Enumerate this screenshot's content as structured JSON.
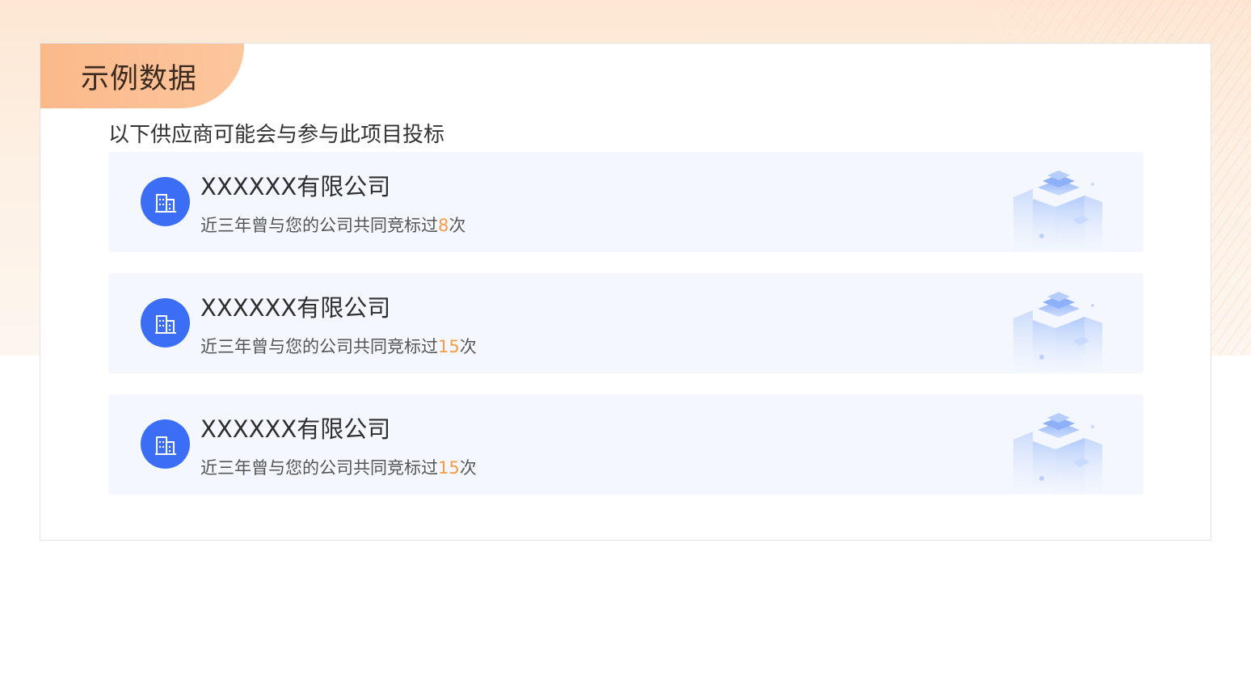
{
  "panel": {
    "tag_label": "示例数据",
    "subtitle": "以下供应商可能会与参与此项目投标"
  },
  "suppliers": [
    {
      "name": "XXXXXX有限公司",
      "desc_prefix": "近三年曾与您的公司共同竞标过",
      "count": "8",
      "desc_suffix": "次",
      "avatar_icon": "building-icon"
    },
    {
      "name": "XXXXXX有限公司",
      "desc_prefix": "近三年曾与您的公司共同竞标过",
      "count": "15",
      "desc_suffix": "次",
      "avatar_icon": "building-icon"
    },
    {
      "name": "XXXXXX有限公司",
      "desc_prefix": "近三年曾与您的公司共同竞标过",
      "count": "15",
      "desc_suffix": "次",
      "avatar_icon": "building-icon"
    }
  ],
  "colors": {
    "tag_bg": "#fbb98a",
    "avatar_bg": "#3c6ef5",
    "count_accent": "#f59a45",
    "card_bg": "#f4f7fd"
  }
}
